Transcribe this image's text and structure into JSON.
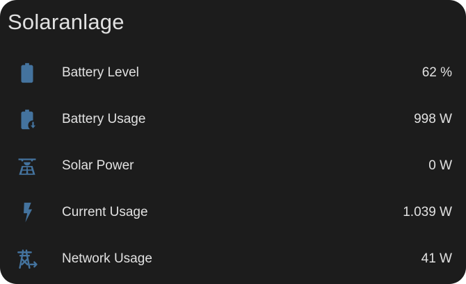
{
  "card": {
    "title": "Solaranlage",
    "accent_color": "#44739e",
    "rows": [
      {
        "icon": "battery-icon",
        "label": "Battery Level",
        "value": "62 %"
      },
      {
        "icon": "battery-charging-down-icon",
        "label": "Battery Usage",
        "value": "998 W"
      },
      {
        "icon": "solar-power-icon",
        "label": "Solar Power",
        "value": "0 W"
      },
      {
        "icon": "lightning-bolt-icon",
        "label": "Current Usage",
        "value": "1.039 W"
      },
      {
        "icon": "transmission-tower-export-icon",
        "label": "Network Usage",
        "value": "41 W"
      }
    ]
  }
}
